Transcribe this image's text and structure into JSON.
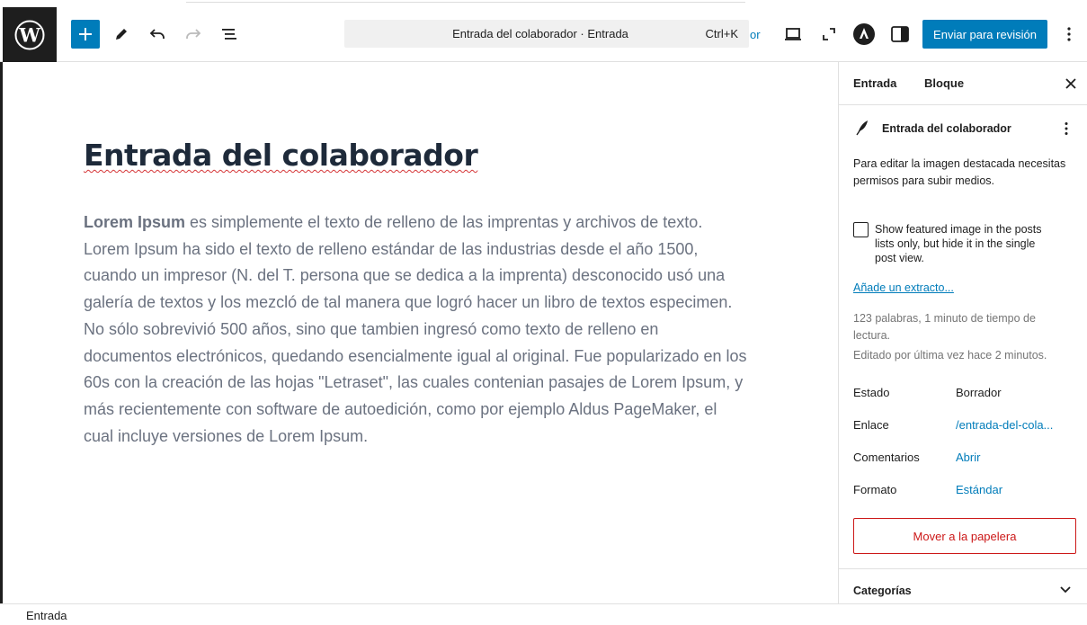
{
  "toolbar": {
    "document_title": "Entrada del colaborador · Entrada",
    "shortcut": "Ctrl+K",
    "overflow_text": "or",
    "submit_label": "Enviar para revisión"
  },
  "post": {
    "title": "Entrada del colaborador",
    "body_bold": "Lorem Ipsum",
    "body_text": " es simplemente el texto de relleno de las imprentas y archivos de texto. Lorem Ipsum ha sido el texto de relleno estándar de las industrias desde el año 1500, cuando un impresor (N. del T. persona que se dedica a la imprenta) desconocido usó una galería de textos y los mezcló de tal manera que logró hacer un libro de textos especimen. No sólo sobrevivió 500 años, sino que tambien ingresó como texto de relleno en documentos electrónicos, quedando esencialmente igual al original. Fue popularizado en los 60s con la creación de las hojas \"Letraset\", las cuales contenian pasajes de Lorem Ipsum, y más recientemente con software de autoedición, como por ejemplo Aldus PageMaker, el cual incluye versiones de Lorem Ipsum."
  },
  "sidebar": {
    "tabs": [
      {
        "label": "Entrada",
        "active": true
      },
      {
        "label": "Bloque",
        "active": false
      }
    ],
    "post_name": "Entrada del colaborador",
    "featured_image_notice": "Para editar la imagen destacada necesitas permisos para subir medios.",
    "featured_checkbox_label": "Show featured image in the posts lists only, but hide it in the single post view.",
    "featured_checkbox_checked": false,
    "excerpt_link": "Añade un extracto...",
    "word_count": "123 palabras, 1 minuto de tiempo de lectura.",
    "last_edited": "Editado por última vez hace 2 minutos.",
    "meta": [
      {
        "label": "Estado",
        "value": "Borrador"
      },
      {
        "label": "Enlace",
        "value": "/entrada-del-cola..."
      },
      {
        "label": "Comentarios",
        "value": "Abrir"
      },
      {
        "label": "Formato",
        "value": "Estándar"
      }
    ],
    "trash_label": "Mover a la papelera",
    "categories_label": "Categorías"
  },
  "footer": {
    "breadcrumb": "Entrada"
  },
  "colors": {
    "accent": "#007cba",
    "danger": "#cc1818",
    "spell_error": "#d63638"
  }
}
